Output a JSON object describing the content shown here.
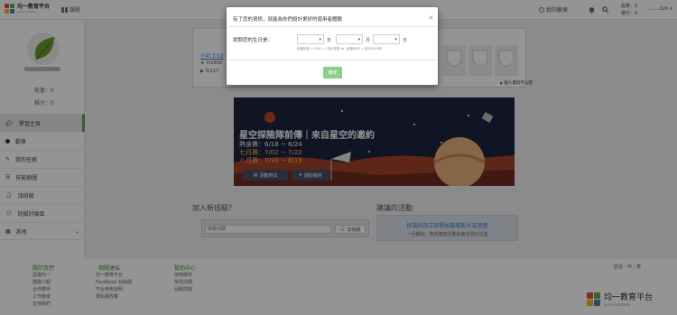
{
  "topbar": {
    "logo_title": "均一教育平台",
    "logo_sub": "Junyi Academy",
    "nav_item": "課程",
    "badges": "我的徽章",
    "energy_line1": "能量：0",
    "energy_line2": "積分：0",
    "username": "........026"
  },
  "sidebar": {
    "stat_energy": "能量：0",
    "stat_points": "積分：0",
    "items": [
      {
        "label": "學習主頁",
        "icon": "graduation-cap-icon"
      },
      {
        "label": "觀章",
        "icon": "dot-icon"
      },
      {
        "label": "我的任務",
        "icon": "pencil-icon"
      },
      {
        "label": "技能樹圖",
        "icon": "list-icon"
      },
      {
        "label": "加班級",
        "icon": "user-plus-icon"
      },
      {
        "label": "班級討論區",
        "icon": "chat-icon"
      },
      {
        "label": "其他",
        "icon": "grid-icon"
      }
    ]
  },
  "profile": {
    "name": "小叭士02",
    "stat1": "0/2856",
    "stat2": "0/127",
    "edit_button": "個人資料不公開"
  },
  "banner": {
    "title": "星空探險隊前傳｜來自星空的邀約",
    "line1": "熱身賽：6/18 ~ 6/24",
    "line2": "七月賽：7/02 ~ 7/22",
    "line3": "八月賽：7/30 ~ 8/19",
    "button_rules": "活動辦法",
    "button_signup": "開始報名"
  },
  "join_class": {
    "title": "加入新班級？",
    "placeholder": "班級代碼",
    "button": "加班級"
  },
  "recommended": {
    "title": "建議的活動",
    "line1": "挑選科目立即開始觀看影片或習題",
    "line2": "一旦開始，您的建議活動就會出現在這邊"
  },
  "modal": {
    "title": "有了您的資訊，就能為你們設計更好的使用者體驗",
    "close": "×",
    "birthday_label": "請問您的生日是：",
    "year_unit": "年",
    "month_unit": "月",
    "day_unit": "日",
    "hint": "民國年齡 = 1911 = 西元年齡 ex. 民國89年 = 西元2000年",
    "confirm": "確定"
  },
  "footer": {
    "col1_title": "關於我們",
    "col1": [
      "認識均一",
      "團隊介紹",
      "合作夥伴",
      "工作機會",
      "支持我們"
    ],
    "col2_title": "相關連結",
    "col2": [
      "均一教育平台",
      "Facebook 粉絲團",
      "平台使用說明",
      "隱私權政策"
    ],
    "col3_title": "幫助中心",
    "col3": [
      "使用條件",
      "常見問題",
      "回報問題"
    ],
    "lang_label": "語言：中｜英",
    "logo_title": "均一教育平台",
    "logo_sub": "Junyi Academy"
  }
}
